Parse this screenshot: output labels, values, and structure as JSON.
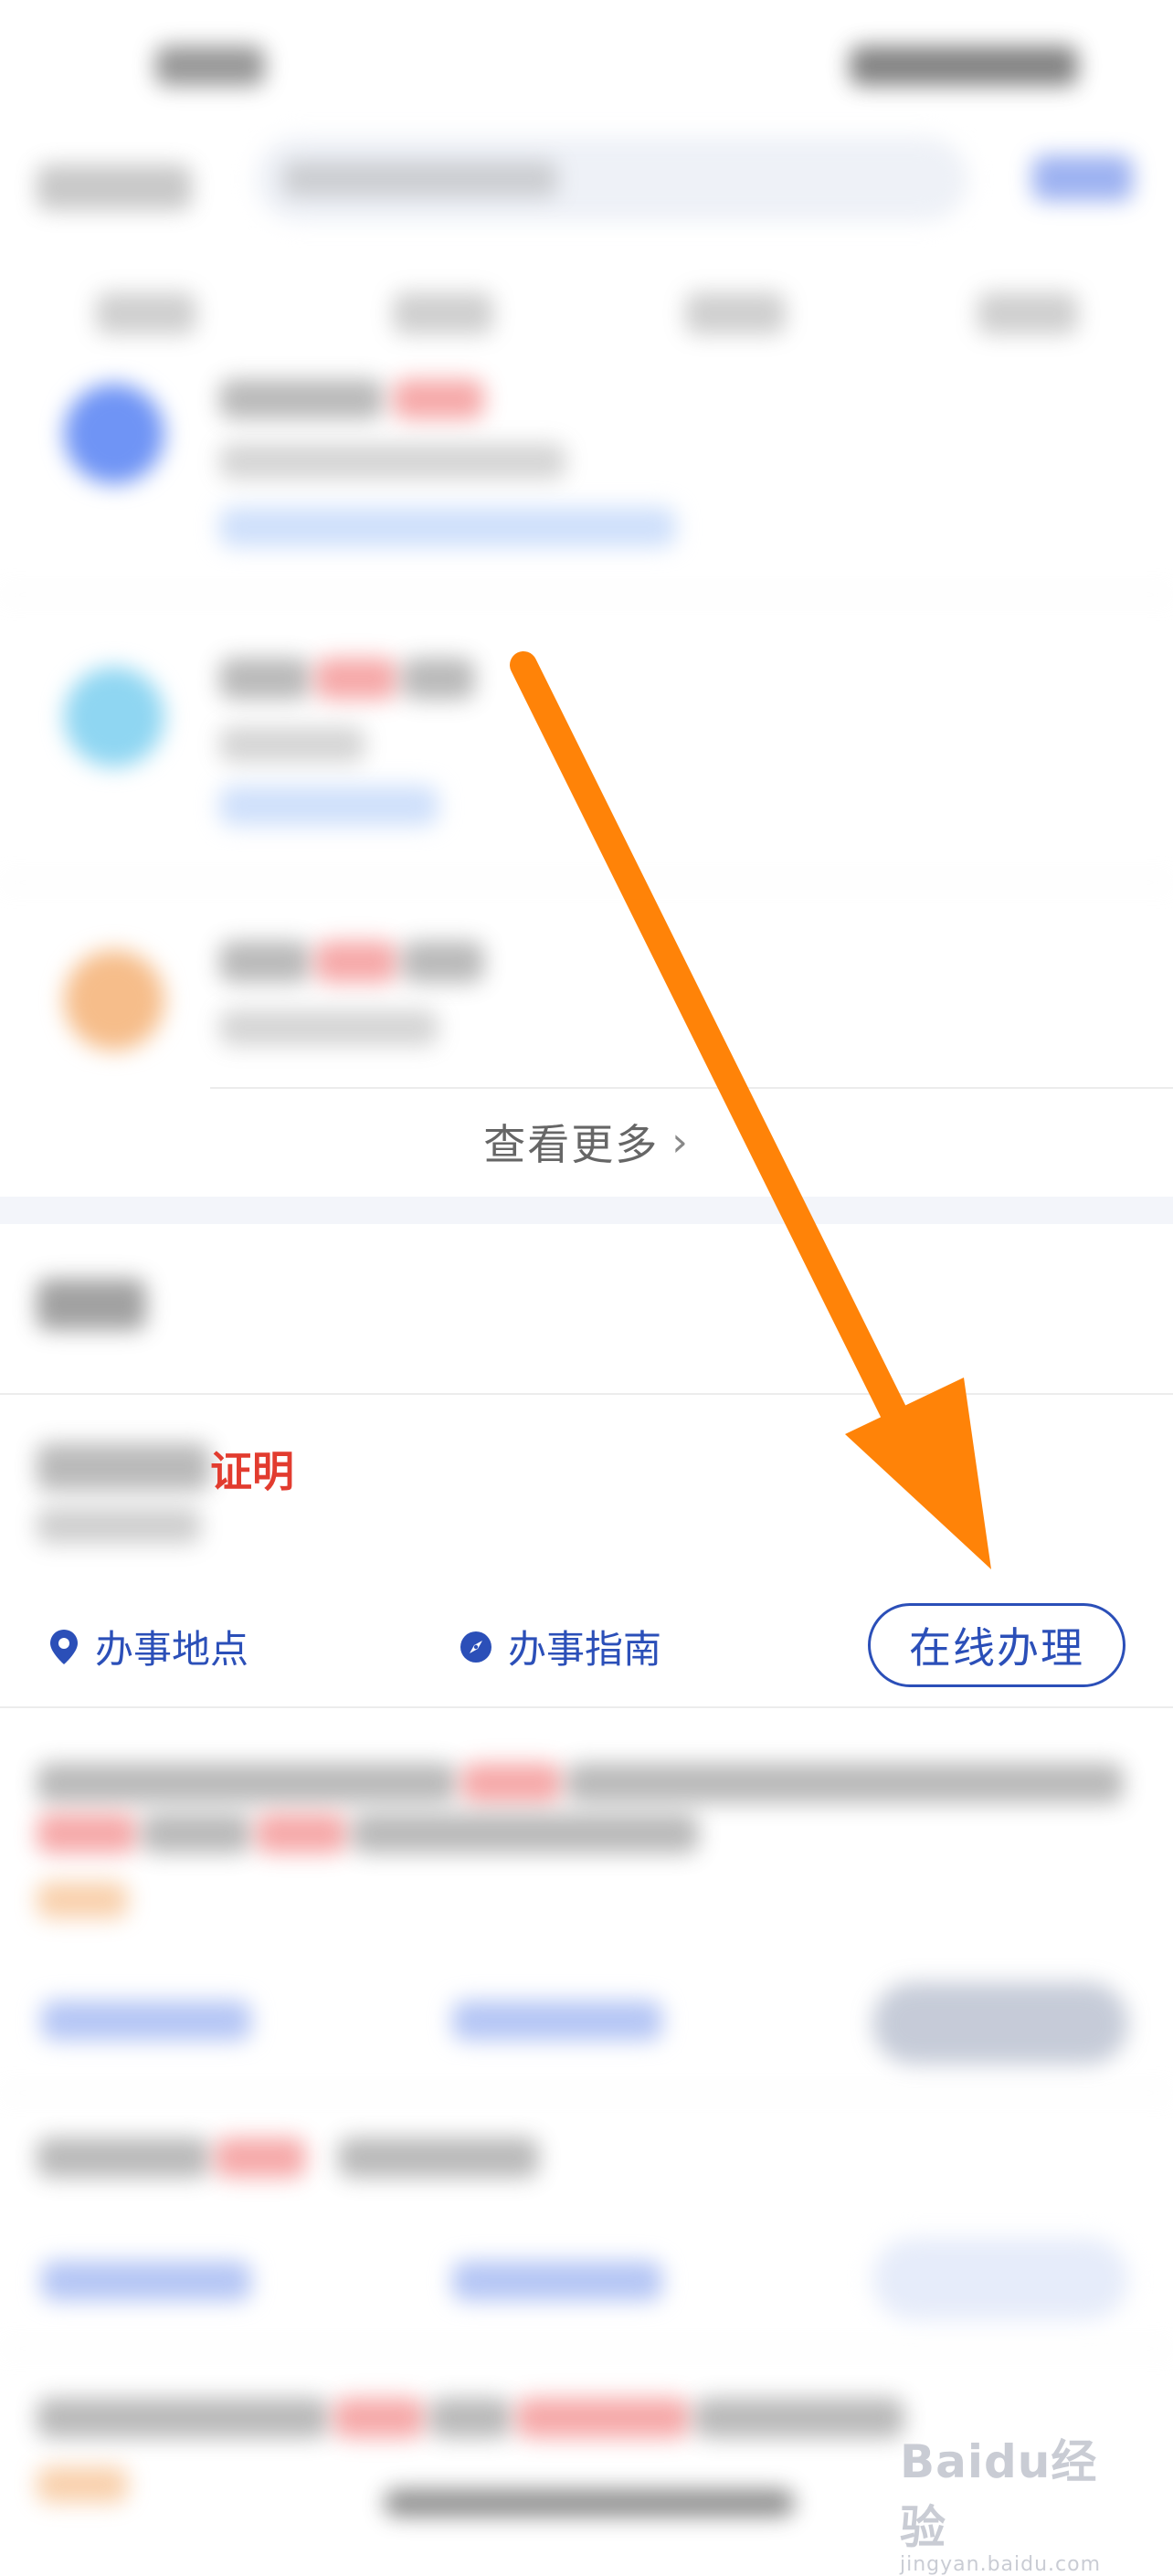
{
  "results": {
    "view_more_label": "查看更多",
    "view_more_chevron": "›"
  },
  "service": {
    "title_visible": "证明",
    "actions": {
      "location_label": "办事地点",
      "guide_label": "办事指南",
      "online_label": "在线办理"
    }
  },
  "watermark": {
    "logo_text": "Baidu经验",
    "url_text": "jingyan.baidu.com"
  },
  "colors": {
    "action_blue": "#2b4fb8",
    "highlight_red": "#e23c2f",
    "arrow_orange": "#ff8308"
  },
  "icons": {
    "location": "location-pin-icon",
    "guide": "compass-icon",
    "view_more": "chevron-right-icon"
  }
}
